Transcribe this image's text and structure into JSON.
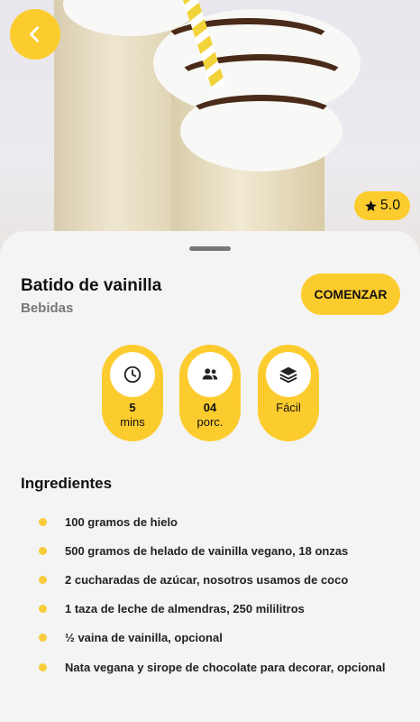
{
  "header": {
    "back_icon": "chevron-left-icon",
    "rating": "5.0",
    "rating_icon": "star-icon"
  },
  "recipe": {
    "title": "Batido de vainilla",
    "category": "Bebidas",
    "start_label": "COMENZAR"
  },
  "stats": {
    "time": {
      "icon": "clock-icon",
      "value": "5",
      "unit": "mins"
    },
    "portions": {
      "icon": "people-icon",
      "value": "04",
      "unit": "porc."
    },
    "difficulty": {
      "icon": "layers-icon",
      "value": "Fácil"
    }
  },
  "ingredients": {
    "title": "Ingredientes",
    "items": [
      "100 gramos de hielo",
      "500 gramos de helado de vainilla vegano, 18 onzas",
      "2 cucharadas de azúcar, nosotros usamos de coco",
      "1 taza de leche de almendras, 250 mililitros",
      "½ vaina de vainilla, opcional",
      "Nata vegana y sirope de chocolate para decorar, opcional"
    ]
  },
  "colors": {
    "accent": "#fccc2e",
    "background": "#f4f4f4",
    "text": "#111111",
    "muted": "#777777"
  }
}
